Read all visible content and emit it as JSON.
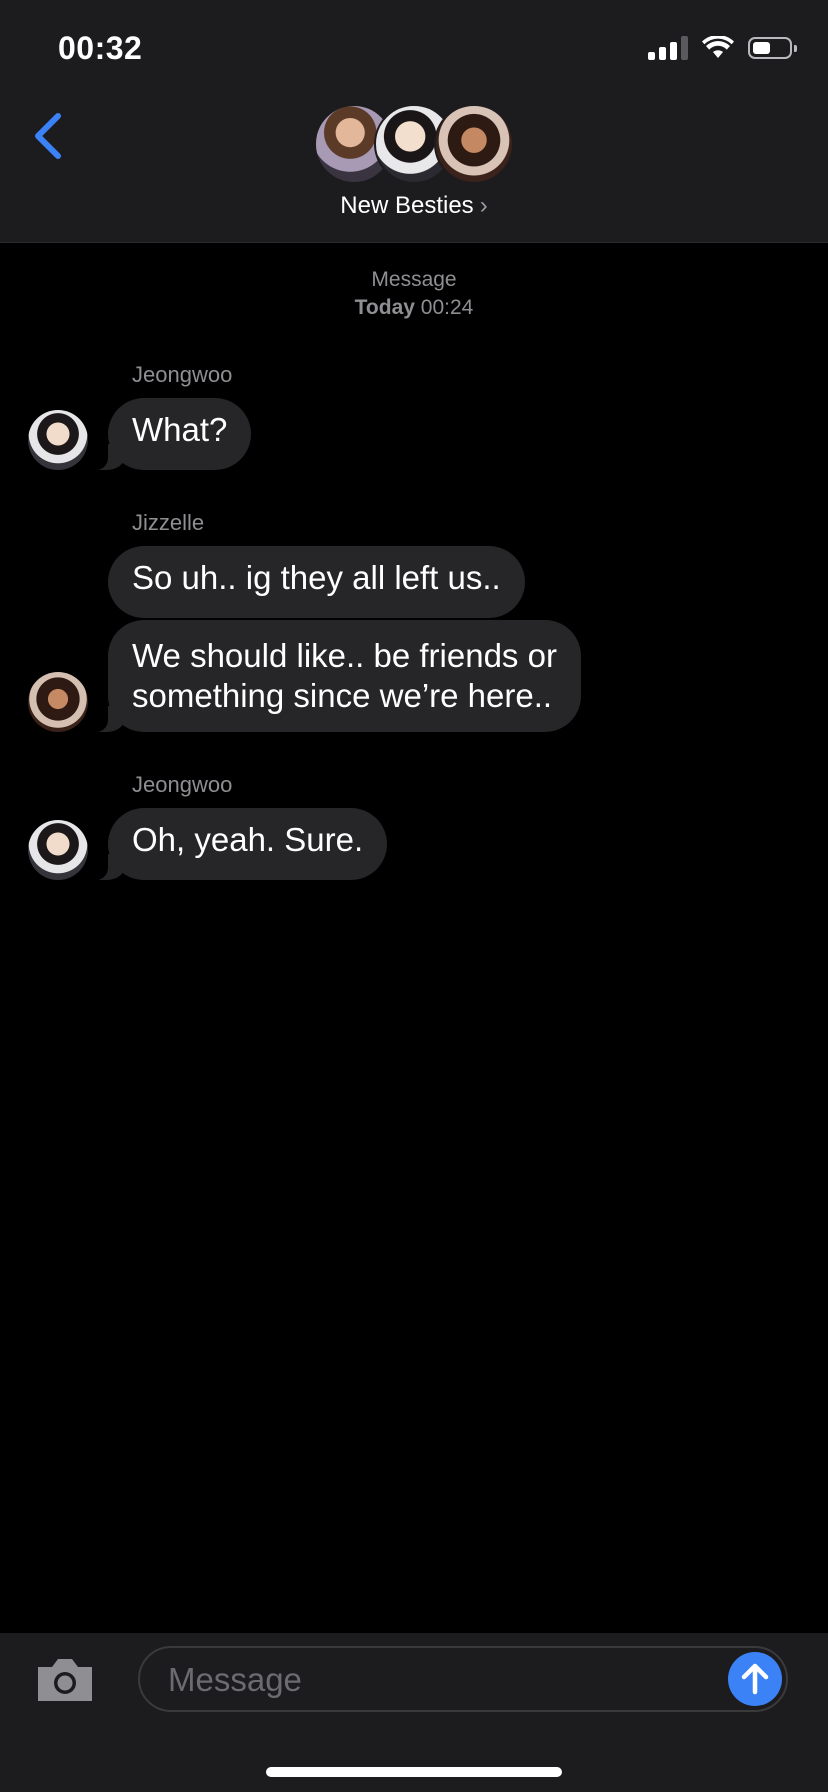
{
  "status_bar": {
    "time": "00:32"
  },
  "header": {
    "group_name": "New Besties",
    "chevron": "›"
  },
  "thread": {
    "timestamp_label": "Message",
    "timestamp_day": "Today",
    "timestamp_time": "00:24",
    "groups": [
      {
        "sender": "Jeongwoo",
        "messages": [
          "What?"
        ]
      },
      {
        "sender": "Jizzelle",
        "messages": [
          "So uh.. ig they all left us..",
          "We should like.. be friends or",
          "something since we’re here.."
        ]
      },
      {
        "sender": "Jeongwoo",
        "messages": [
          "Oh, yeah. Sure."
        ]
      }
    ]
  },
  "composer": {
    "placeholder": "Message"
  },
  "icons": {
    "back": "chevron-left-icon",
    "camera": "camera-icon",
    "send": "arrow-up-icon",
    "signal": "cellular-signal-icon",
    "wifi": "wifi-icon",
    "battery": "battery-icon"
  },
  "colors": {
    "accent": "#3b82f6",
    "bubble": "#262628",
    "bar": "#1c1c1e",
    "muted_text": "#8e8e93"
  }
}
